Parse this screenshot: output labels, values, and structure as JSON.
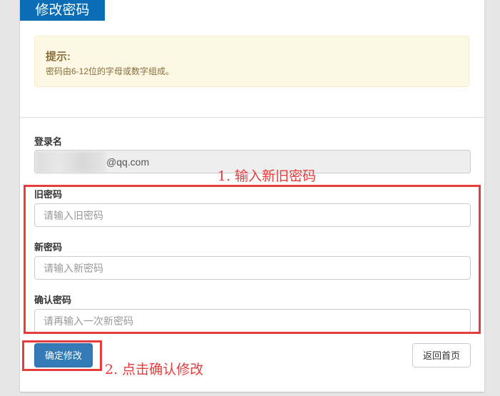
{
  "header": {
    "title": "修改密码"
  },
  "alert": {
    "title": "提示:",
    "message": "密码由6-12位的字母或数字组成。"
  },
  "form": {
    "login_label": "登录名",
    "login_value": "@qq.com",
    "old_label": "旧密码",
    "old_placeholder": "请输入旧密码",
    "new_label": "新密码",
    "new_placeholder": "请输入新密码",
    "confirm_label": "确认密码",
    "confirm_placeholder": "请再输入一次新密码",
    "submit_label": "确定修改",
    "back_label": "返回首页"
  },
  "annotations": {
    "step1": "1. 输入新旧密码",
    "step2": "2. 点击确认修改"
  },
  "colors": {
    "header": "#0a6db5",
    "primary": "#337ab7",
    "annotation": "#e53c3c"
  }
}
